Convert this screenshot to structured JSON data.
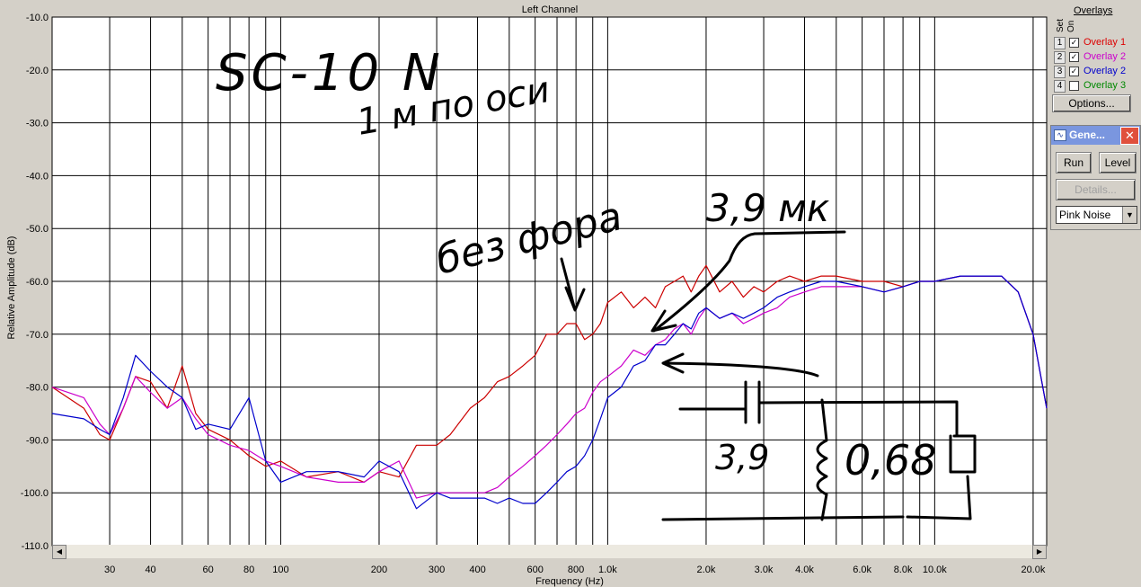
{
  "chart_data": {
    "type": "line",
    "title": "Left Channel",
    "xlabel": "Frequency (Hz)",
    "ylabel": "Relative Amplitude (dB)",
    "xscale": "log",
    "xlim": [
      20,
      22000
    ],
    "ylim": [
      -110,
      -10
    ],
    "grid": true,
    "x_ticks": [
      {
        "v": 30,
        "label": "30"
      },
      {
        "v": 40,
        "label": "40"
      },
      {
        "v": 60,
        "label": "60"
      },
      {
        "v": 80,
        "label": "80"
      },
      {
        "v": 100,
        "label": "100"
      },
      {
        "v": 200,
        "label": "200"
      },
      {
        "v": 300,
        "label": "300"
      },
      {
        "v": 400,
        "label": "400"
      },
      {
        "v": 600,
        "label": "600"
      },
      {
        "v": 800,
        "label": "800"
      },
      {
        "v": 1000,
        "label": "1.0k"
      },
      {
        "v": 2000,
        "label": "2.0k"
      },
      {
        "v": 3000,
        "label": "3.0k"
      },
      {
        "v": 4000,
        "label": "4.0k"
      },
      {
        "v": 6000,
        "label": "6.0k"
      },
      {
        "v": 8000,
        "label": "8.0k"
      },
      {
        "v": 10000,
        "label": "10.0k"
      },
      {
        "v": 20000,
        "label": "20.0k"
      }
    ],
    "x_grid": [
      30,
      40,
      50,
      60,
      70,
      80,
      90,
      100,
      200,
      300,
      400,
      500,
      600,
      700,
      800,
      900,
      1000,
      2000,
      3000,
      4000,
      5000,
      6000,
      7000,
      8000,
      9000,
      10000,
      20000
    ],
    "y_ticks": [
      {
        "v": -10,
        "label": "-10.0"
      },
      {
        "v": -20,
        "label": "-20.0"
      },
      {
        "v": -30,
        "label": "-30.0"
      },
      {
        "v": -40,
        "label": "-40.0"
      },
      {
        "v": -50,
        "label": "-50.0"
      },
      {
        "v": -60,
        "label": "-60.0"
      },
      {
        "v": -70,
        "label": "-70.0"
      },
      {
        "v": -80,
        "label": "-80.0"
      },
      {
        "v": -90,
        "label": "-90.0"
      },
      {
        "v": -100,
        "label": "-100.0"
      },
      {
        "v": -110,
        "label": "-110.0"
      }
    ],
    "series": [
      {
        "name": "Overlay 1",
        "color": "#cc0000",
        "x": [
          20,
          25,
          28,
          30,
          33,
          36,
          40,
          45,
          50,
          55,
          60,
          70,
          80,
          90,
          100,
          120,
          150,
          180,
          200,
          230,
          260,
          300,
          330,
          380,
          420,
          460,
          500,
          550,
          600,
          650,
          700,
          750,
          800,
          850,
          900,
          950,
          1000,
          1100,
          1200,
          1300,
          1400,
          1500,
          1600,
          1700,
          1800,
          1900,
          2000,
          2200,
          2400,
          2600,
          2800,
          3000,
          3300,
          3600,
          4000,
          4500,
          5000,
          6000,
          7000,
          8000,
          9000,
          10000,
          12000,
          14000,
          16000,
          18000,
          20000,
          22000
        ],
        "y": [
          -80,
          -84,
          -89,
          -90,
          -84,
          -78,
          -79,
          -84,
          -76,
          -85,
          -88,
          -90,
          -93,
          -95,
          -94,
          -97,
          -96,
          -98,
          -96,
          -97,
          -91,
          -91,
          -89,
          -84,
          -82,
          -79,
          -78,
          -76,
          -74,
          -70,
          -70,
          -68,
          -68,
          -71,
          -70,
          -68,
          -64,
          -62,
          -65,
          -63,
          -65,
          -61,
          -60,
          -59,
          -62,
          -59,
          -57,
          -62,
          -60,
          -63,
          -61,
          -62,
          -60,
          -59,
          -60,
          -59,
          -59,
          -60,
          -60,
          -61,
          -60,
          -60,
          -59,
          -59,
          -59,
          -62,
          -70,
          -84
        ]
      },
      {
        "name": "Overlay 2",
        "color": "#cc00cc",
        "x": [
          20,
          25,
          28,
          30,
          33,
          36,
          40,
          45,
          50,
          55,
          60,
          70,
          80,
          90,
          100,
          120,
          150,
          180,
          200,
          230,
          260,
          300,
          330,
          380,
          420,
          460,
          500,
          550,
          600,
          650,
          700,
          750,
          800,
          850,
          900,
          950,
          1000,
          1100,
          1200,
          1300,
          1400,
          1500,
          1600,
          1700,
          1800,
          1900,
          2000,
          2200,
          2400,
          2600,
          2800,
          3000,
          3300,
          3600,
          4000,
          4500,
          5000,
          6000,
          7000,
          8000,
          9000,
          10000,
          12000,
          14000,
          16000,
          18000,
          20000,
          22000
        ],
        "y": [
          -80,
          -82,
          -87,
          -89,
          -84,
          -78,
          -81,
          -84,
          -82,
          -86,
          -89,
          -91,
          -92,
          -94,
          -95,
          -97,
          -98,
          -98,
          -96,
          -94,
          -101,
          -100,
          -100,
          -100,
          -100,
          -99,
          -97,
          -95,
          -93,
          -91,
          -89,
          -87,
          -85,
          -84,
          -81,
          -79,
          -78,
          -76,
          -73,
          -74,
          -72,
          -71,
          -69,
          -68,
          -70,
          -67,
          -65,
          -67,
          -66,
          -68,
          -67,
          -66,
          -65,
          -63,
          -62,
          -61,
          -61,
          -61,
          -62,
          -61,
          -60,
          -60,
          -59,
          -59,
          -59,
          -62,
          -70,
          -84
        ]
      },
      {
        "name": "Overlay 2",
        "color": "#0000cc",
        "x": [
          20,
          25,
          28,
          30,
          33,
          36,
          40,
          45,
          50,
          55,
          60,
          70,
          80,
          90,
          100,
          120,
          150,
          180,
          200,
          230,
          260,
          300,
          330,
          380,
          420,
          460,
          500,
          550,
          600,
          650,
          700,
          750,
          800,
          850,
          900,
          950,
          1000,
          1100,
          1200,
          1300,
          1400,
          1500,
          1600,
          1700,
          1800,
          1900,
          2000,
          2200,
          2400,
          2600,
          2800,
          3000,
          3300,
          3600,
          4000,
          4500,
          5000,
          6000,
          7000,
          8000,
          9000,
          10000,
          12000,
          14000,
          16000,
          18000,
          20000,
          22000
        ],
        "y": [
          -85,
          -86,
          -88,
          -89,
          -82,
          -74,
          -77,
          -80,
          -82,
          -88,
          -87,
          -88,
          -82,
          -94,
          -98,
          -96,
          -96,
          -97,
          -94,
          -96,
          -103,
          -100,
          -101,
          -101,
          -101,
          -102,
          -101,
          -102,
          -102,
          -100,
          -98,
          -96,
          -95,
          -93,
          -90,
          -86,
          -82,
          -80,
          -76,
          -75,
          -72,
          -72,
          -70,
          -68,
          -69,
          -66,
          -65,
          -67,
          -66,
          -67,
          -66,
          -65,
          -63,
          -62,
          -61,
          -60,
          -60,
          -61,
          -62,
          -61,
          -60,
          -60,
          -59,
          -59,
          -59,
          -62,
          -70,
          -84
        ]
      }
    ]
  },
  "handwriting": {
    "model": "SC-10 N",
    "distance": "1 м по оси",
    "no_filter": "без фора",
    "cap_value": "3,9 мк",
    "cap_label": "3,9",
    "res_label": "0,68"
  },
  "overlays": {
    "title": "Overlays",
    "set_header": "Set",
    "on_header": "On",
    "items": [
      {
        "set": "1",
        "checked": true,
        "label": "Overlay 1",
        "color": "#dd0000"
      },
      {
        "set": "2",
        "checked": true,
        "label": "Overlay 2",
        "color": "#cc00cc"
      },
      {
        "set": "3",
        "checked": true,
        "label": "Overlay 2",
        "color": "#0000cc"
      },
      {
        "set": "4",
        "checked": false,
        "label": "Overlay 3",
        "color": "#008800"
      }
    ],
    "options_label": "Options..."
  },
  "generator": {
    "title": "Gene...",
    "run_label": "Run",
    "level_label": "Level",
    "details_label": "Details...",
    "signal": "Pink Noise"
  }
}
